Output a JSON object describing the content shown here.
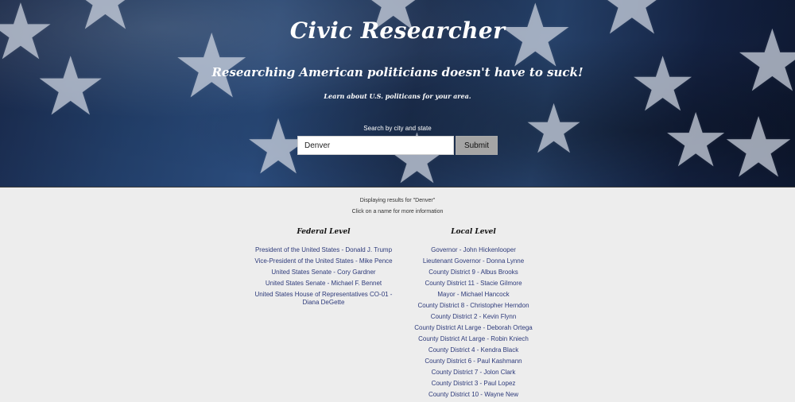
{
  "hero": {
    "title": "Civic Researcher",
    "tagline": "Researching American politicians doesn't have to suck!",
    "subtagline": "Learn about U.S. politicans for your area."
  },
  "search": {
    "label": "Search by city and state",
    "value": "Denver",
    "submit_label": "Submit"
  },
  "results": {
    "header": "Displaying results for \"Denver\"",
    "hint": "Click on a name for more information"
  },
  "federal": {
    "title": "Federal Level",
    "items": [
      "President of the United States - Donald J. Trump",
      "Vice-President of the United States - Mike Pence",
      "United States Senate - Cory Gardner",
      "United States Senate - Michael F. Bennet",
      "United States House of Representatives CO-01 - Diana DeGette"
    ]
  },
  "local": {
    "title": "Local Level",
    "items": [
      "Governor - John Hickenlooper",
      "Lieutenant Governor - Donna Lynne",
      "County District 9 - Albus Brooks",
      "County District 11 - Stacie Gilmore",
      "Mayor - Michael Hancock",
      "County District 8 - Christopher Herndon",
      "County District 2 - Kevin Flynn",
      "County District At Large - Deborah Ortega",
      "County District At Large - Robin Kniech",
      "County District 4 - Kendra Black",
      "County District 6 - Paul Kashmann",
      "County District 7 - Jolon Clark",
      "County District 3 - Paul Lopez",
      "County District 10 - Wayne New"
    ]
  },
  "colors": {
    "hero_background": "#24426f",
    "link": "#2d3a7a",
    "body_background": "#ededed",
    "submit_background": "#a5a5a5"
  },
  "icons": {
    "decorative_stars": "star-icon"
  }
}
